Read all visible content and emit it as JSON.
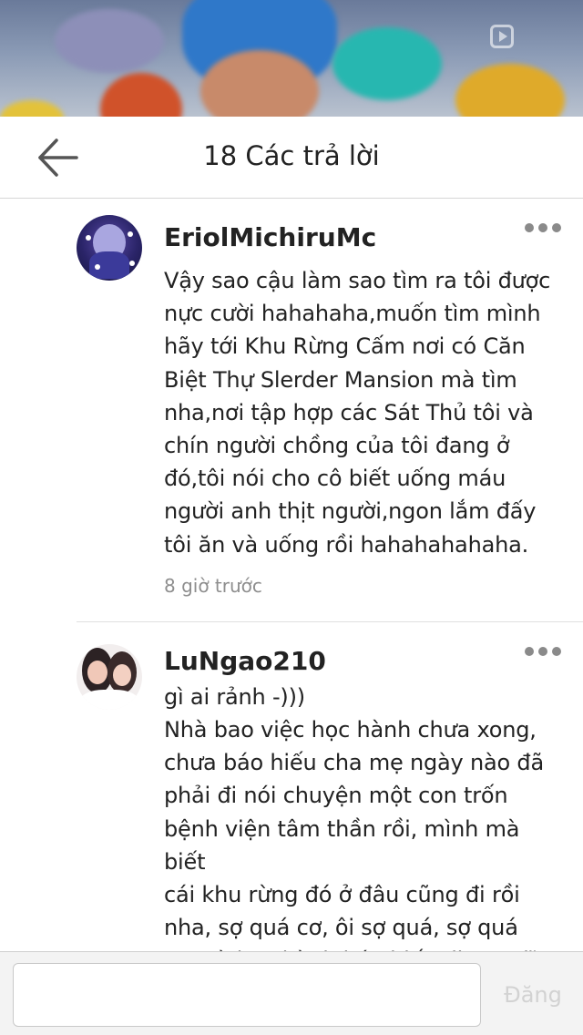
{
  "header": {
    "title": "18 Các trả lời",
    "back_icon": "arrow-left-icon"
  },
  "comments": [
    {
      "username": "EriolMichiruMc",
      "text": "Vậy sao cậu làm sao tìm ra tôi được\nnực cười hahahaha,muốn tìm mình\nhãy tới Khu Rừng Cấm nơi có Căn\nBiệt Thự Slerder Mansion mà tìm\nnha,nơi tập hợp các Sát Thủ tôi và\nchín người chồng của tôi đang ở\nđó,tôi nói cho cô biết uống máu\nngười anh thịt người,ngon lắm đấy\ntôi ăn và uống rồi hahahahahaha.",
      "time": "8 giờ trước",
      "more_icon": "more-horizontal-icon"
    },
    {
      "username": "LuNgao210",
      "text": "gì ai rảnh -)))\nNhà bao việc học hành chưa xong,\nchưa báo hiếu cha mẹ ngày nào đã\nphải đi nói chuyện một con trốn\nbệnh viện tâm thần rồi, mình mà biết\ncái khu rừng đó ở đâu cũng đi rồi\nnha, sợ quá cơ, ôi sợ quá, sợ quá\nLo mà học hành báo hiếu đi con đĩ, ở",
      "more_icon": "more-horizontal-icon"
    }
  ],
  "reply_bar": {
    "input_value": "",
    "post_label": "Đăng"
  }
}
